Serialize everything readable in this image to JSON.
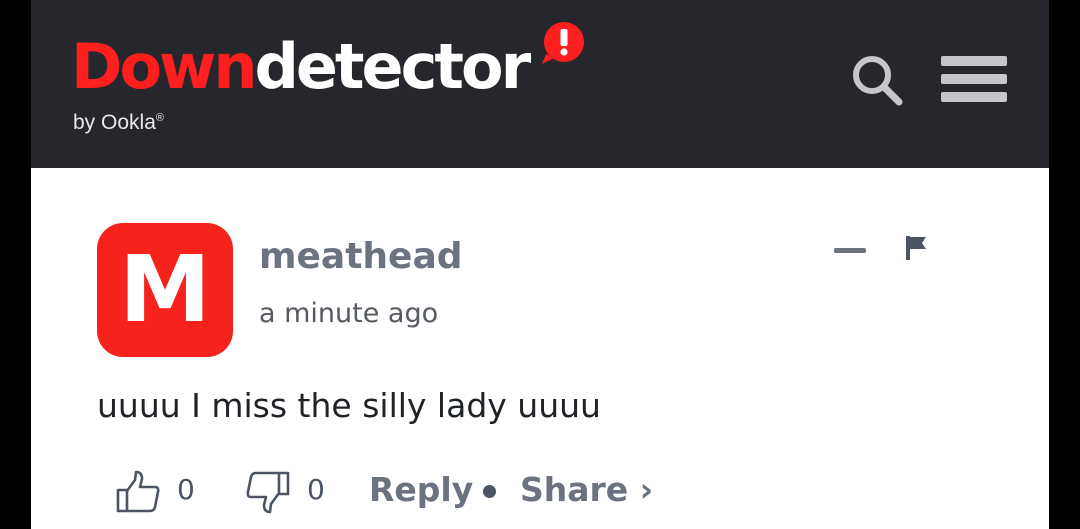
{
  "header": {
    "logo_down": "Down",
    "logo_detector": "detector",
    "byline": "by Ookla",
    "byline_mark": "®"
  },
  "icons": {
    "search": "search-icon",
    "menu": "hamburger-menu-icon",
    "badge": "exclamation-badge-icon",
    "collapse": "minus-icon",
    "flag": "flag-icon",
    "upvote": "thumbs-up-icon",
    "downvote": "thumbs-down-icon"
  },
  "comment": {
    "avatar_letter": "M",
    "username": "meathead",
    "timestamp": "a minute ago",
    "text": "uuuu I miss the silly lady uuuu",
    "upvotes": "0",
    "downvotes": "0",
    "reply_label": "Reply",
    "share_label": "Share ›"
  },
  "colors": {
    "brand_red": "#ff1f1f",
    "header_bg": "#26272d",
    "avatar_bg": "#f5231b"
  }
}
